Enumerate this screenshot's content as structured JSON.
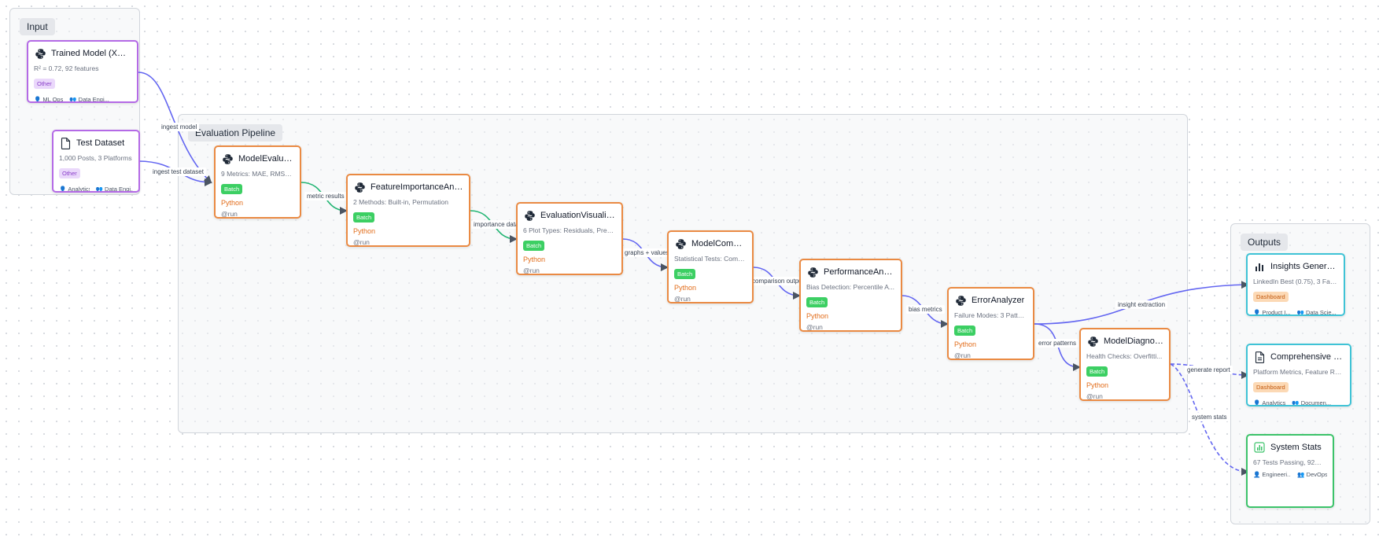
{
  "groups": {
    "input": "Input",
    "pipeline": "Evaluation Pipeline",
    "outputs": "Outputs"
  },
  "nodes": {
    "trained_model": {
      "title": "Trained Model (XGB...",
      "desc": "R² = 0.72, 92 features",
      "badge": "Other",
      "owner": "ML Ops",
      "team": "Data Engi..."
    },
    "test_dataset": {
      "title": "Test Dataset",
      "desc": "1,000 Posts, 3 Platforms",
      "badge": "Other",
      "owner": "Analytics",
      "team": "Data Engi..."
    },
    "model_evaluator": {
      "title": "ModelEvaluator",
      "desc": "9 Metrics: MAE, RMSE, ...",
      "badge": "Batch",
      "lang": "Python",
      "run": "@run"
    },
    "feature_importance": {
      "title": "FeatureImportanceAnaly...",
      "desc": "2 Methods: Built-in, Permutation",
      "badge": "Batch",
      "lang": "Python",
      "run": "@run"
    },
    "evaluation_visualizer": {
      "title": "EvaluationVisualizer",
      "desc": "6 Plot Types: Residuals, Predi...",
      "badge": "Batch",
      "lang": "Python",
      "run": "@run"
    },
    "model_compa": {
      "title": "ModelCompa...",
      "desc": "Statistical Tests: Comp...",
      "badge": "Batch",
      "lang": "Python",
      "run": "@run"
    },
    "performance_anal": {
      "title": "PerformanceAnal...",
      "desc": "Bias Detection: Percentile A...",
      "badge": "Batch",
      "lang": "Python",
      "run": "@run"
    },
    "error_analyzer": {
      "title": "ErrorAnalyzer",
      "desc": "Failure Modes: 3 Patter...",
      "badge": "Batch",
      "lang": "Python",
      "run": "@run"
    },
    "model_diagnost": {
      "title": "ModelDiagnost...",
      "desc": "Health Checks: Overfitti...",
      "badge": "Batch",
      "lang": "Python",
      "run": "@run"
    },
    "insights": {
      "title": "Insights Generated",
      "desc": "LinkedIn Best (0.75), 3 Fail...",
      "badge": "Dashboard",
      "owner": "Product I...",
      "team": "Data Scie..."
    },
    "report": {
      "title": "Comprehensive Re...",
      "desc": "Platform Metrics, Feature Ran...",
      "badge": "Dashboard",
      "owner": "Analytics",
      "team": "Documen..."
    },
    "system_stats": {
      "title": "System Stats",
      "desc": "67 Tests Passing, 92% ...",
      "owner": "Engineeri...",
      "team": "DevOps"
    }
  },
  "edges": {
    "ingest_model": "ingest model",
    "ingest_test": "ingest test dataset",
    "metric_results": "metric results",
    "importance_data": "importance data",
    "graphs_values": "graphs + values",
    "comparison_outputs": "comparison outputs",
    "bias_metrics": "bias metrics",
    "error_patterns": "error patterns",
    "insight_extraction": "insight extraction",
    "generate_report": "generate report",
    "system_stats": "system stats"
  },
  "colors": {
    "processor_border": "#ea8a43",
    "input_border": "#b46ae6",
    "output_border": "#3fc3d6",
    "stats_border": "#3cc36a",
    "edge_blue": "#6366f1",
    "edge_green": "#22b573",
    "arrow": "#4b5563"
  },
  "icons": {
    "processor": "python-icon",
    "dataset": "document-icon",
    "insights": "bar-chart-icon",
    "report": "document-icon",
    "stats": "bar-chart-icon",
    "owner": "person-icon",
    "team": "people-icon"
  }
}
